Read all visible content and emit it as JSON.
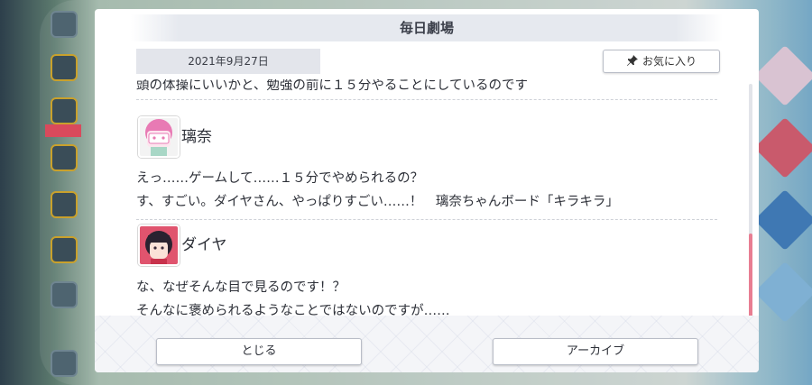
{
  "panel": {
    "title": "毎日劇場",
    "date": "2021年9月27日",
    "favorite_label": "お気に入り"
  },
  "story": {
    "cut_line": "頭の体操にいいかと、勉強の前に１５分やることにしているのです",
    "blocks": [
      {
        "speaker": "璃奈",
        "lines": [
          "えっ……ゲームして……１５分でやめられるの？",
          "す、すごい。ダイヤさん、やっぱりすごい……！　璃奈ちゃんボード「キラキラ」"
        ]
      },
      {
        "speaker": "ダイヤ",
        "lines": [
          "な、なぜそんな目で見るのです！？",
          "そんなに褒められるようなことではないのですが……"
        ]
      }
    ]
  },
  "footer": {
    "close_label": "とじる",
    "archive_label": "アーカイブ"
  },
  "colors": {
    "accent_pink": "#e87e92",
    "text": "#2d3038"
  },
  "icons": [
    "pin-icon",
    "rina-avatar",
    "dia-avatar"
  ]
}
